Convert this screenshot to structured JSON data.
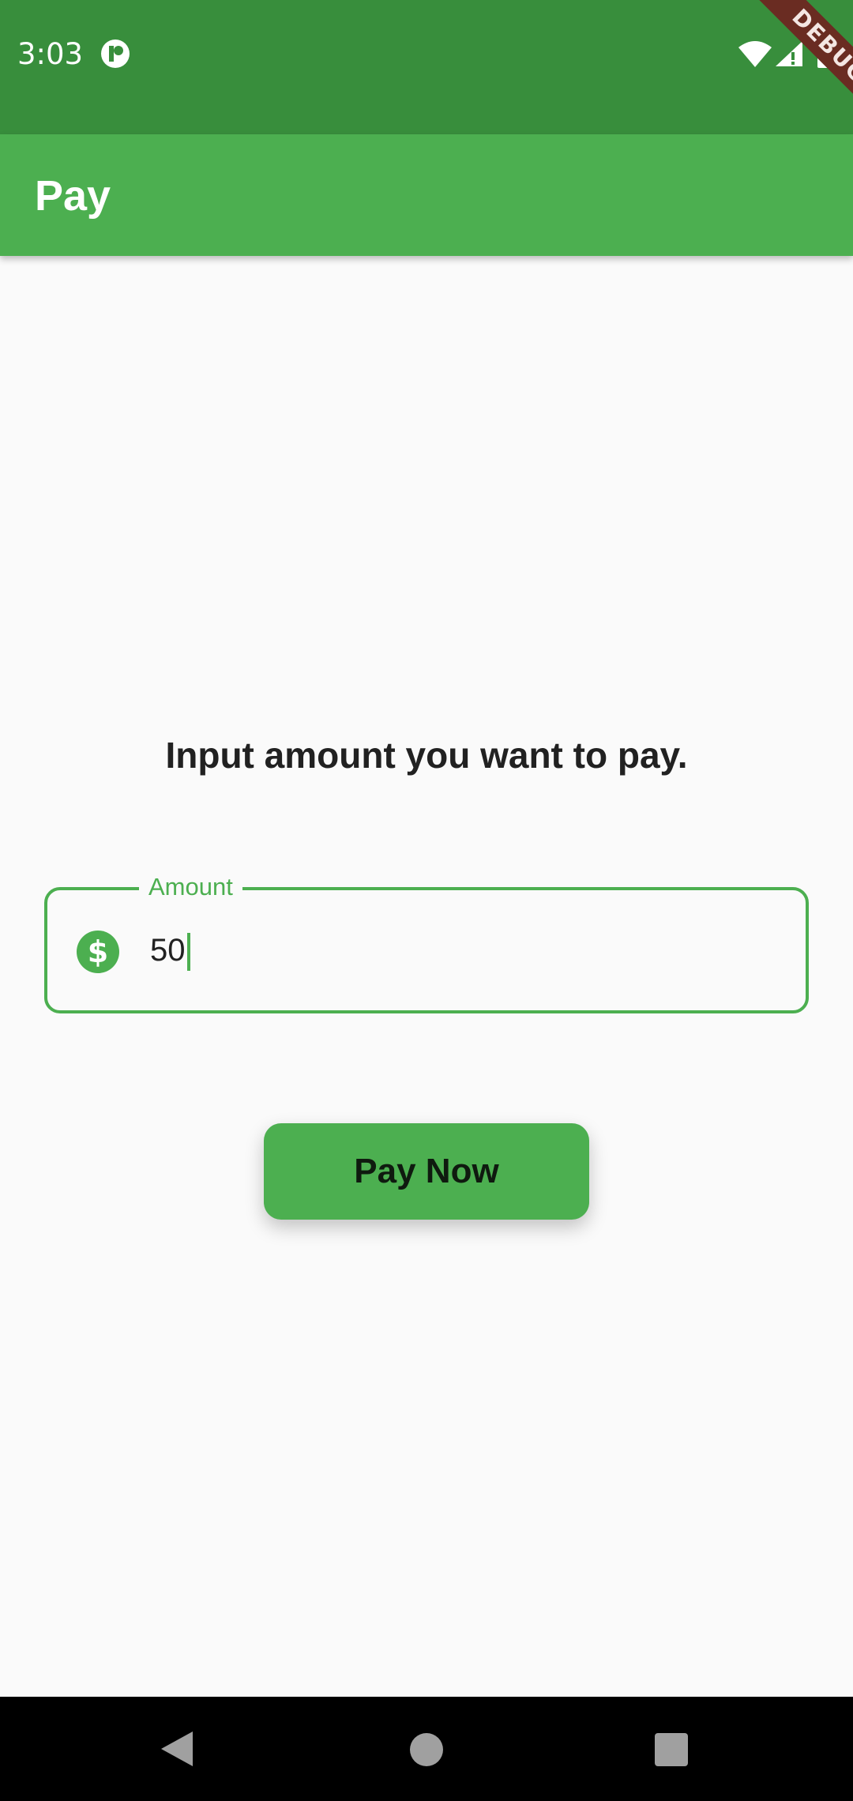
{
  "status_bar": {
    "time": "3:03",
    "icons": [
      "notification-p-icon",
      "wifi-icon",
      "signal-icon",
      "battery-icon"
    ]
  },
  "debug_banner": "DEBUG",
  "app_bar": {
    "title": "Pay"
  },
  "main": {
    "prompt": "Input amount you want to pay.",
    "amount_field": {
      "label": "Amount",
      "value": "50",
      "prefix_icon": "dollar-circle-icon"
    },
    "pay_button_label": "Pay Now"
  },
  "nav_bar": {
    "icons": [
      "back-icon",
      "home-icon",
      "recents-icon"
    ]
  },
  "colors": {
    "primary": "#4caf50",
    "primary_dark": "#388e3c",
    "background": "#fafafa",
    "debug_ribbon": "#6a2c22"
  }
}
